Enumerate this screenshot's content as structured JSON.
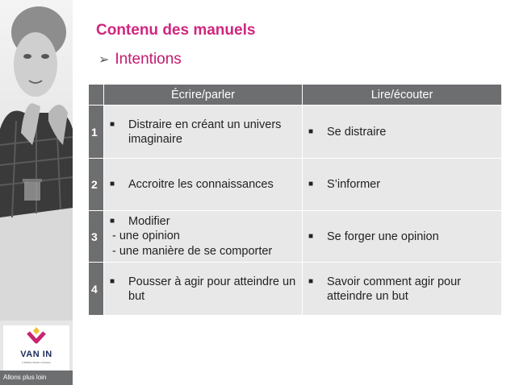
{
  "sidebar": {
    "brand": "VAN IN",
    "brand_sub": "a Wolters Kluwer company",
    "tagline": "Allons plus loin"
  },
  "slide": {
    "title": "Contenu des manuels",
    "subtitle": "Intentions"
  },
  "table": {
    "headers": [
      "",
      "Écrire/parler",
      "Lire/écouter"
    ],
    "rows": [
      {
        "num": "1",
        "write": "Distraire en créant un univers imaginaire",
        "read": "Se distraire"
      },
      {
        "num": "2",
        "write": "Accroitre les connaissances",
        "read": "S’informer"
      },
      {
        "num": "3",
        "write": "Modifier",
        "write_items": [
          "une opinion",
          "une manière de se comporter"
        ],
        "read": "Se forger une opinion"
      },
      {
        "num": "4",
        "write": "Pousser à agir pour atteindre un but",
        "read": "Savoir comment agir pour atteindre un but"
      }
    ]
  },
  "colors": {
    "title": "#d0267e",
    "header_bg": "#6d6e70",
    "cell_bg": "#e8e8e8",
    "logo_magenta": "#c8246f",
    "logo_yellow": "#f2c12e"
  },
  "icons": {
    "bullet": "square-bullet-icon",
    "subtitle": "arrow-bullet-icon"
  }
}
